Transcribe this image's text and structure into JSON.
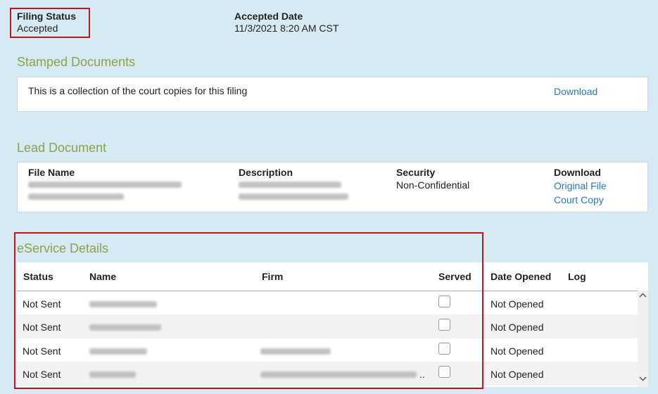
{
  "filing": {
    "status_label": "Filing Status",
    "status_value": "Accepted",
    "accepted_label": "Accepted Date",
    "accepted_value": "11/3/2021 8:20 AM CST"
  },
  "stamped": {
    "title": "Stamped Documents",
    "description": "This is a collection of the court copies for this filing",
    "download_label": "Download"
  },
  "lead": {
    "title": "Lead Document",
    "headers": {
      "file_name": "File Name",
      "description": "Description",
      "security": "Security",
      "download": "Download"
    },
    "security_value": "Non-Confidential",
    "original_file_label": "Original File",
    "court_copy_label": "Court Copy"
  },
  "eservice": {
    "title": "eService Details",
    "headers": {
      "status": "Status",
      "name": "Name",
      "firm": "Firm",
      "served": "Served",
      "date_opened": "Date Opened",
      "log": "Log"
    },
    "rows": [
      {
        "status": "Not Sent",
        "served": false,
        "date_opened": "Not Opened"
      },
      {
        "status": "Not Sent",
        "served": false,
        "date_opened": "Not Opened"
      },
      {
        "status": "Not Sent",
        "served": false,
        "date_opened": "Not Opened"
      },
      {
        "status": "Not Sent",
        "served": false,
        "date_opened": "Not Opened"
      }
    ],
    "ellipsis": ".."
  },
  "icons": {
    "scroll_up": "chevron-up-icon",
    "scroll_down": "chevron-down-icon"
  },
  "colors": {
    "background": "#d6eaf4",
    "section_title": "#8aa34a",
    "link": "#2a7ab8",
    "highlight_box": "#c0161b"
  }
}
